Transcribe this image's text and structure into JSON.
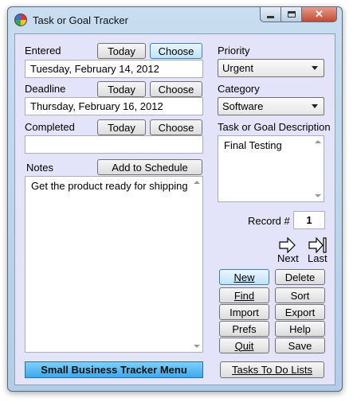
{
  "window": {
    "title": "Task or Goal Tracker"
  },
  "entered": {
    "label": "Entered",
    "value": "Tuesday, February 14, 2012"
  },
  "deadline": {
    "label": "Deadline",
    "value": "Thursday, February 16, 2012"
  },
  "completed": {
    "label": "Completed",
    "value": ""
  },
  "date_buttons": {
    "today": "Today",
    "choose": "Choose"
  },
  "notes": {
    "label": "Notes",
    "add_to_schedule": "Add to Schedule",
    "value": "Get the product ready for shipping"
  },
  "priority": {
    "label": "Priority",
    "selected": "Urgent"
  },
  "category": {
    "label": "Category",
    "selected": "Software"
  },
  "description": {
    "label": "Task or Goal Description",
    "value": "Final Testing"
  },
  "record": {
    "label": "Record #",
    "value": "1"
  },
  "navigation": {
    "next": "Next",
    "last": "Last"
  },
  "actions": {
    "new": "New",
    "delete": "Delete",
    "find": "Find",
    "sort": "Sort",
    "import": "Import",
    "export": "Export",
    "prefs": "Prefs",
    "help": "Help",
    "quit": "Quit",
    "save": "Save"
  },
  "footer": {
    "menu": "Small Business Tracker Menu",
    "tasks": "Tasks To Do Lists"
  },
  "colors": {
    "client_bg": "#e3e4fa",
    "menu_button": "#3aa9ee",
    "title_bar": "#c9ddf0"
  }
}
